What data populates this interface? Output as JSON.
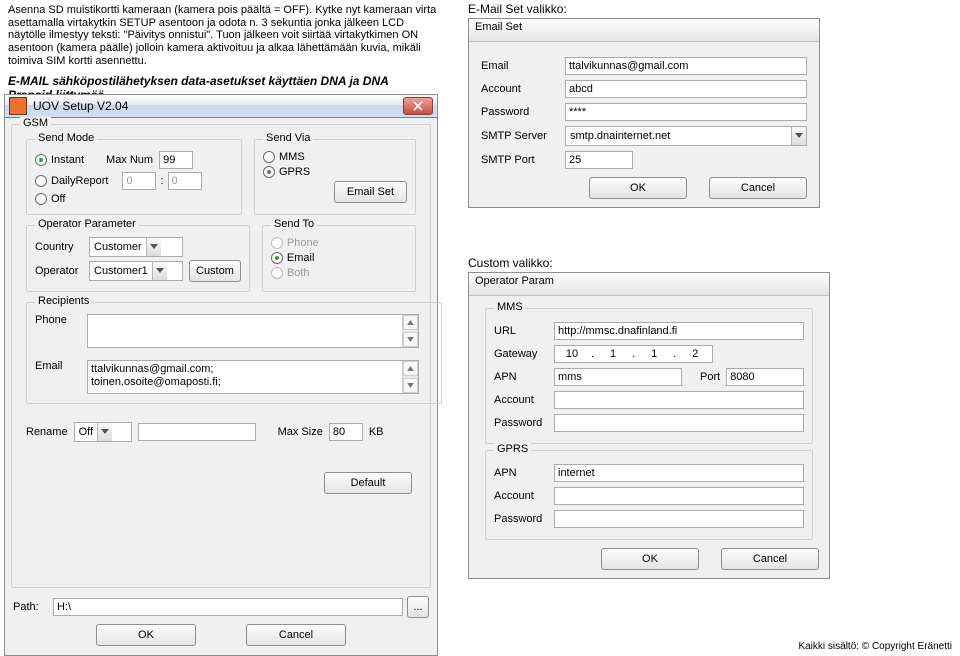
{
  "intro": {
    "line1": "Asenna SD muistikortti kameraan (kamera pois päältä = OFF). Kytke nyt kameraan virta asettamalla virtakytkin SETUP asentoon ja odota n. 3 sekuntia jonka jälkeen LCD näytölle ilmestyy teksti: \"Päivitys onnistui\". Tuon jälkeen voit siirtää virtakytkimen ON asentoon (kamera päälle) jolloin kamera aktivoituu ja alkaa lähettämään kuvia, mikäli toimiva SIM kortti asennettu.",
    "heading": "E-MAIL sähköpostilähetyksen data-asetukset käyttäen DNA ja DNA Prepaid liittymää"
  },
  "main": {
    "title": "UOV Setup V2.04",
    "gsm": {
      "legend": "GSM",
      "sendmode": {
        "legend": "Send Mode",
        "instant": "Instant",
        "maxnum_lbl": "Max Num",
        "maxnum": "99",
        "daily": "DailyReport",
        "d1": "0",
        "d2": "0",
        "off": "Off"
      },
      "sendvia": {
        "legend": "Send Via",
        "mms": "MMS",
        "gprs": "GPRS",
        "emailset": "Email Set"
      },
      "op": {
        "legend": "Operator Parameter",
        "country_lbl": "Country",
        "country": "Customer",
        "operator_lbl": "Operator",
        "operator": "Customer1",
        "custom_btn": "Custom"
      },
      "sendto": {
        "legend": "Send To",
        "phone": "Phone",
        "email": "Email",
        "both": "Both"
      },
      "recip": {
        "legend": "Recipients",
        "phone_lbl": "Phone",
        "phone_val": "",
        "email_lbl": "Email",
        "email_val": "ttalvikunnas@gmail.com;\ntoinen.osoite@omaposti.fi;"
      },
      "rename_lbl": "Rename",
      "rename_val": "Off",
      "maxsize_lbl": "Max Size",
      "maxsize_val": "80",
      "kb": "KB",
      "default_btn": "Default"
    },
    "path_lbl": "Path:",
    "path_val": "H:\\",
    "browse_btn": "...",
    "ok": "OK",
    "cancel": "Cancel"
  },
  "emailset_title": "E-Mail Set valikko:",
  "emailset": {
    "win_title": "Email Set",
    "email_lbl": "Email",
    "email": "ttalvikunnas@gmail.com",
    "acc_lbl": "Account",
    "acc": "abcd",
    "pwd_lbl": "Password",
    "pwd": "****",
    "smtp_lbl": "SMTP Server",
    "smtp": "smtp.dnainternet.net",
    "port_lbl": "SMTP Port",
    "port": "25",
    "ok": "OK",
    "cancel": "Cancel"
  },
  "custom_title": "Custom valikko:",
  "opparam": {
    "win_title": "Operator Param",
    "mms": {
      "legend": "MMS",
      "url_lbl": "URL",
      "url": "http://mmsc.dnafinland.fi",
      "gw_lbl": "Gateway",
      "gw": [
        "10",
        "1",
        "1",
        "2"
      ],
      "apn_lbl": "APN",
      "apn": "mms",
      "port_lbl": "Port",
      "port": "8080",
      "acc_lbl": "Account",
      "acc": "",
      "pwd_lbl": "Password",
      "pwd": ""
    },
    "gprs": {
      "legend": "GPRS",
      "apn_lbl": "APN",
      "apn": "internet",
      "acc_lbl": "Account",
      "acc": "",
      "pwd_lbl": "Password",
      "pwd": ""
    },
    "ok": "OK",
    "cancel": "Cancel"
  },
  "footer": "Kaikki sisältö: © Copyright Eränetti"
}
